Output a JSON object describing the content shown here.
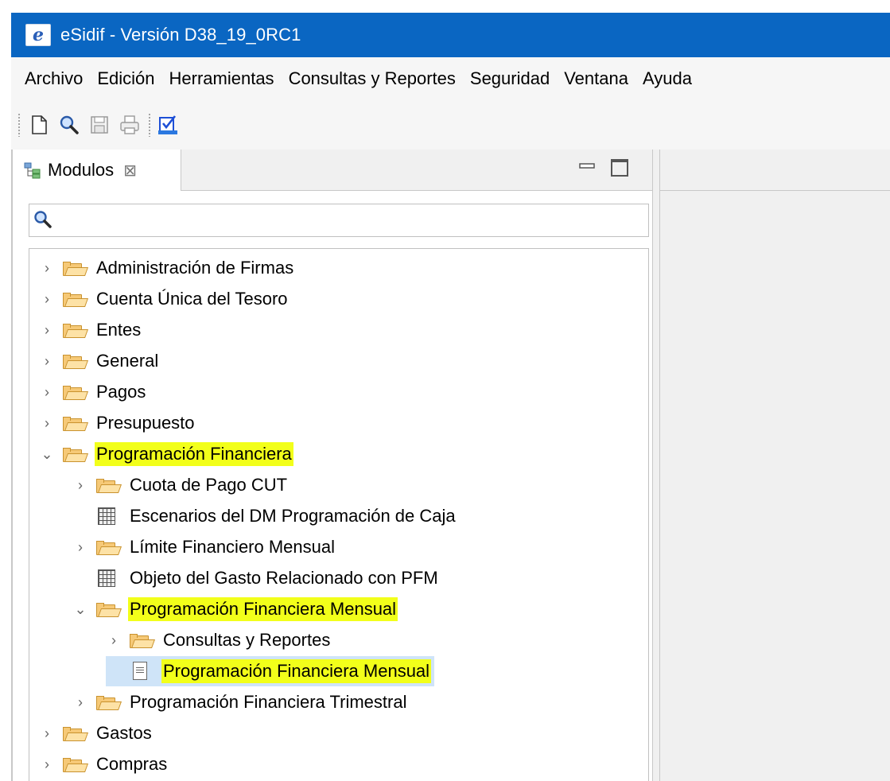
{
  "window": {
    "title": "eSidif - Versión D38_19_0RC1",
    "app_icon": "esidif-logo-icon"
  },
  "menubar": {
    "items": [
      "Archivo",
      "Edición",
      "Herramientas",
      "Consultas y Reportes",
      "Seguridad",
      "Ventana",
      "Ayuda"
    ]
  },
  "toolbar": {
    "buttons": [
      "new-document-icon",
      "search-icon",
      "save-icon",
      "print-icon",
      "checklist-icon"
    ]
  },
  "modules_view": {
    "tab_label": "Modulos",
    "close_glyph": "⊠"
  },
  "tree": {
    "items": [
      {
        "label": "Administración de Firmas",
        "icon": "folder-icon",
        "expander": "›",
        "highlight": false
      },
      {
        "label": "Cuenta Única del Tesoro",
        "icon": "folder-icon",
        "expander": "›",
        "highlight": false
      },
      {
        "label": "Entes",
        "icon": "folder-icon",
        "expander": "›",
        "highlight": false
      },
      {
        "label": "General",
        "icon": "folder-icon",
        "expander": "›",
        "highlight": false
      },
      {
        "label": "Pagos",
        "icon": "folder-icon",
        "expander": "›",
        "highlight": false
      },
      {
        "label": "Presupuesto",
        "icon": "folder-icon",
        "expander": "›",
        "highlight": false
      },
      {
        "label": "Programación Financiera",
        "icon": "folder-icon",
        "expander": "⌄",
        "highlight": true
      },
      {
        "label": "Cuota de Pago CUT",
        "icon": "folder-icon",
        "expander": "›",
        "highlight": false
      },
      {
        "label": "Escenarios del DM Programación de Caja",
        "icon": "grid-icon",
        "expander": "",
        "highlight": false
      },
      {
        "label": "Límite Financiero Mensual",
        "icon": "folder-icon",
        "expander": "›",
        "highlight": false
      },
      {
        "label": "Objeto del Gasto Relacionado con PFM",
        "icon": "grid-icon",
        "expander": "",
        "highlight": false
      },
      {
        "label": "Programación Financiera Mensual",
        "icon": "folder-icon",
        "expander": "⌄",
        "highlight": true
      },
      {
        "label": "Consultas y Reportes",
        "icon": "folder-icon",
        "expander": "›",
        "highlight": false
      },
      {
        "label": "Programación Financiera Mensual",
        "icon": "document-icon",
        "expander": "",
        "highlight": true,
        "selected": true
      },
      {
        "label": "Programación Financiera Trimestral",
        "icon": "folder-icon",
        "expander": "›",
        "highlight": false
      },
      {
        "label": "Gastos",
        "icon": "folder-icon",
        "expander": "›",
        "highlight": false
      },
      {
        "label": "Compras",
        "icon": "folder-icon",
        "expander": "›",
        "highlight": false
      }
    ]
  },
  "colors": {
    "titlebar": "#0a66c2",
    "highlight": "#f2ff1a",
    "selection": "#cfe4f8"
  }
}
